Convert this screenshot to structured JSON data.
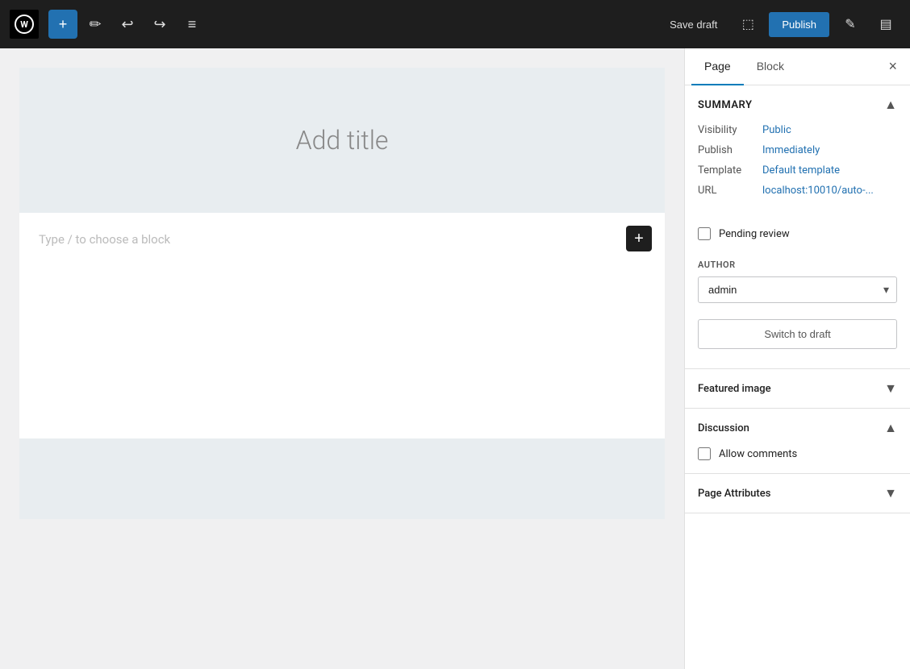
{
  "toolbar": {
    "wp_logo_label": "WordPress",
    "add_block_label": "+",
    "edit_label": "✏",
    "undo_label": "↩",
    "redo_label": "↪",
    "list_view_label": "≡",
    "save_draft_label": "Save draft",
    "publish_label": "Publish",
    "preview_icon_label": "⬜",
    "post_info_icon_label": "✎",
    "settings_icon_label": "⊟"
  },
  "editor": {
    "title_placeholder": "Add title",
    "block_placeholder": "Type / to choose a block",
    "add_block_btn_label": "+"
  },
  "sidebar": {
    "tab_page_label": "Page",
    "tab_block_label": "Block",
    "close_label": "×",
    "summary_title": "Summary",
    "visibility_label": "Visibility",
    "visibility_value": "Public",
    "publish_label": "Publish",
    "publish_value": "Immediately",
    "template_label": "Template",
    "template_value": "Default template",
    "url_label": "URL",
    "url_value": "localhost:10010/auto-...",
    "pending_review_label": "Pending review",
    "author_label": "AUTHOR",
    "author_value": "admin",
    "switch_draft_label": "Switch to draft",
    "featured_image_label": "Featured image",
    "discussion_label": "Discussion",
    "allow_comments_label": "Allow comments",
    "page_attributes_label": "Page Attributes"
  },
  "icons": {
    "chevron_up": "▲",
    "chevron_down": "▼",
    "close": "×"
  }
}
